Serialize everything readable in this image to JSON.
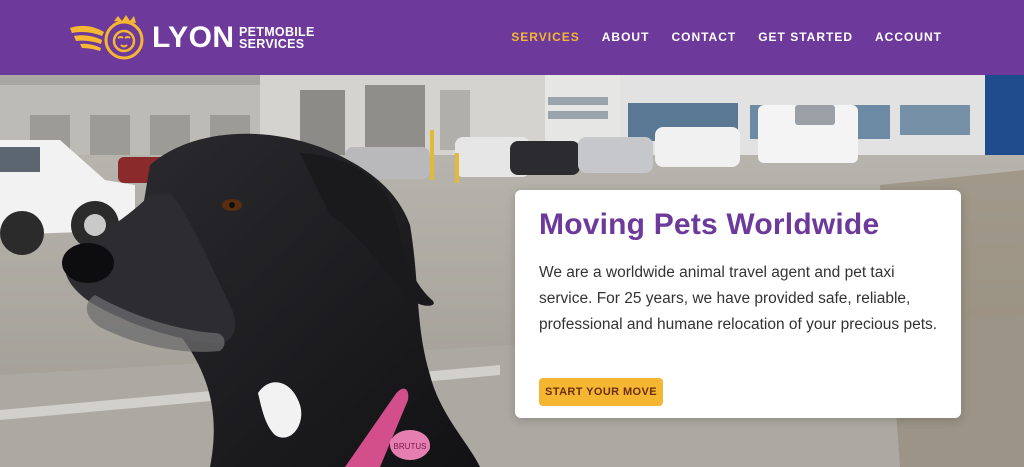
{
  "brand": {
    "name": "LYON",
    "sub_line1": "PETMOBILE",
    "sub_line2": "SERVICES",
    "logo_icon": "winged-lion-logo-icon"
  },
  "nav": {
    "items": [
      {
        "label": "SERVICES",
        "active": true
      },
      {
        "label": "ABOUT",
        "active": false
      },
      {
        "label": "CONTACT",
        "active": false
      },
      {
        "label": "GET STARTED",
        "active": false
      },
      {
        "label": "ACCOUNT",
        "active": false
      }
    ]
  },
  "hero": {
    "title": "Moving Pets Worldwide",
    "body": "We are a worldwide animal travel agent and pet taxi service. For 25 years, we have provided safe, reliable, professional and humane relocation of your precious pets.",
    "cta_label": "START YOUR MOVE",
    "photo": "black-dog-in-parking-lot-photo",
    "tag_text": "BRUTUS"
  },
  "colors": {
    "header_bg": "#6d3a9c",
    "accent": "#f5b731",
    "title": "#6d3a9c"
  }
}
